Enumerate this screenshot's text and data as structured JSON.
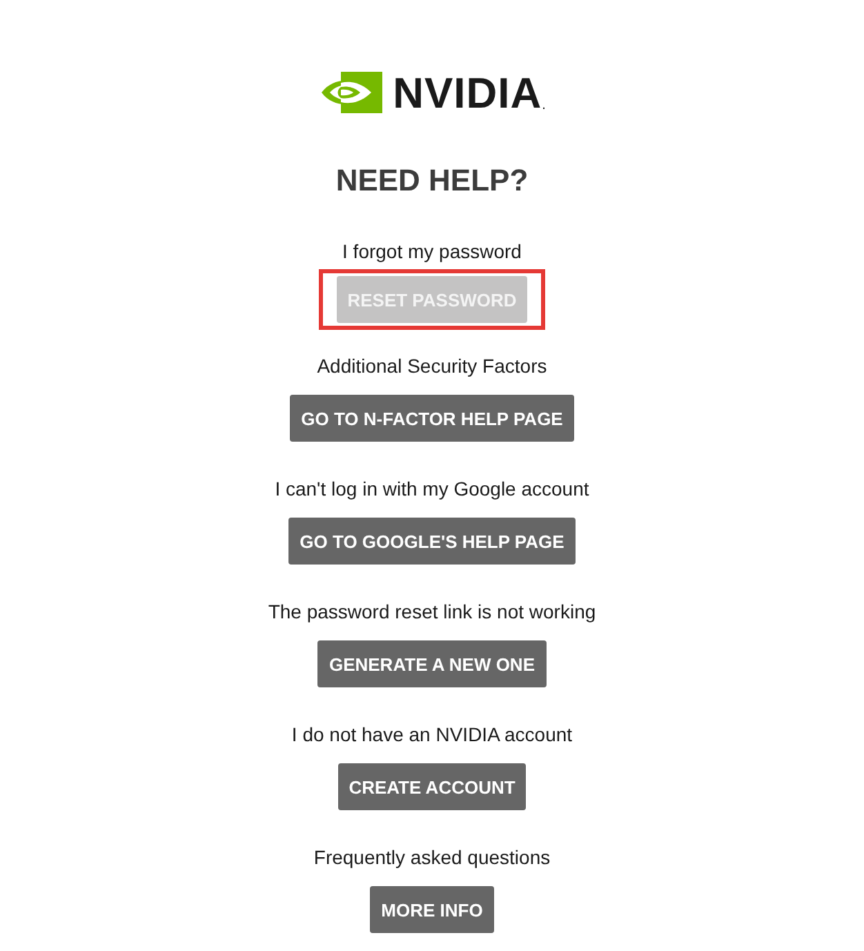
{
  "logo": {
    "wordmark": "NVIDIA",
    "mark": "."
  },
  "title": "NEED HELP?",
  "sections": [
    {
      "prompt": "I forgot my password",
      "button": "RESET PASSWORD",
      "disabled": true,
      "highlighted": true
    },
    {
      "prompt": "Additional Security Factors",
      "button": "GO TO N-FACTOR HELP PAGE",
      "disabled": false,
      "highlighted": false
    },
    {
      "prompt": "I can't log in with my Google account",
      "button": "GO TO GOOGLE'S HELP PAGE",
      "disabled": false,
      "highlighted": false
    },
    {
      "prompt": "The password reset link is not working",
      "button": "GENERATE A NEW ONE",
      "disabled": false,
      "highlighted": false
    },
    {
      "prompt": "I do not have an NVIDIA account",
      "button": "CREATE ACCOUNT",
      "disabled": false,
      "highlighted": false
    },
    {
      "prompt": "Frequently asked questions",
      "button": "MORE INFO",
      "disabled": false,
      "highlighted": false
    }
  ]
}
